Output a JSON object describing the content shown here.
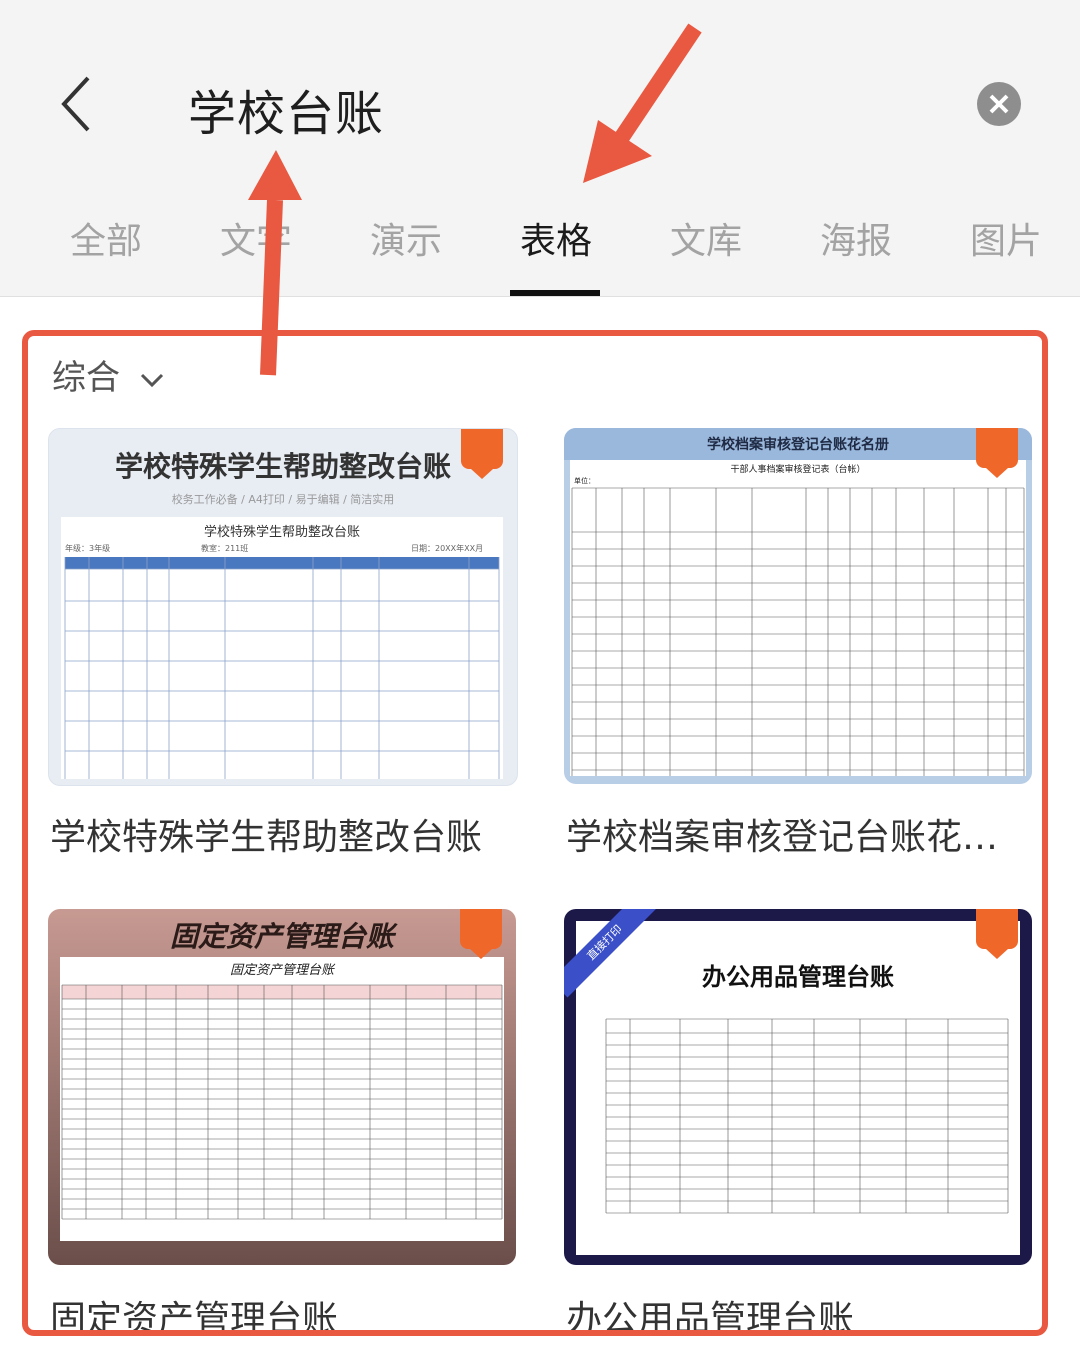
{
  "header": {
    "search_text": "学校台账"
  },
  "tabs": [
    {
      "label": "全部"
    },
    {
      "label": "文字"
    },
    {
      "label": "演示"
    },
    {
      "label": "表格"
    },
    {
      "label": "文库"
    },
    {
      "label": "海报"
    },
    {
      "label": "图片"
    }
  ],
  "active_tab": "表格",
  "sort": {
    "label": "综合"
  },
  "results": [
    {
      "title": "学校特殊学生帮助整改台账",
      "thumb_title": "学校特殊学生帮助整改台账",
      "thumb_subtitle": "校务工作必备 / A4打印 / 易于编辑 / 简洁实用",
      "sheet_title": "学校特殊学生帮助整改台账",
      "meta_left": "年级：3年级",
      "meta_mid": "教室：211班",
      "meta_right": "日期：20XX年XX月"
    },
    {
      "title": "学校档案审核登记台账花…",
      "thumb_title": "学校档案审核登记台账花名册",
      "sheet_title": "干部人事档案审核登记表（台帐）",
      "unit_label": "单位："
    },
    {
      "title": "固定资产管理台账",
      "thumb_title": "固定资产管理台账",
      "sheet_title": "固定资产管理台账"
    },
    {
      "title": "办公用品管理台账",
      "thumb_title": "办公用品管理台账",
      "ribbon": "直接打印"
    }
  ],
  "colors": {
    "annotation": "#e95840",
    "badge": "#f0672a"
  },
  "icons": [
    "back-arrow-icon",
    "clear-icon",
    "chevron-down-icon",
    "template-badge-icon"
  ]
}
